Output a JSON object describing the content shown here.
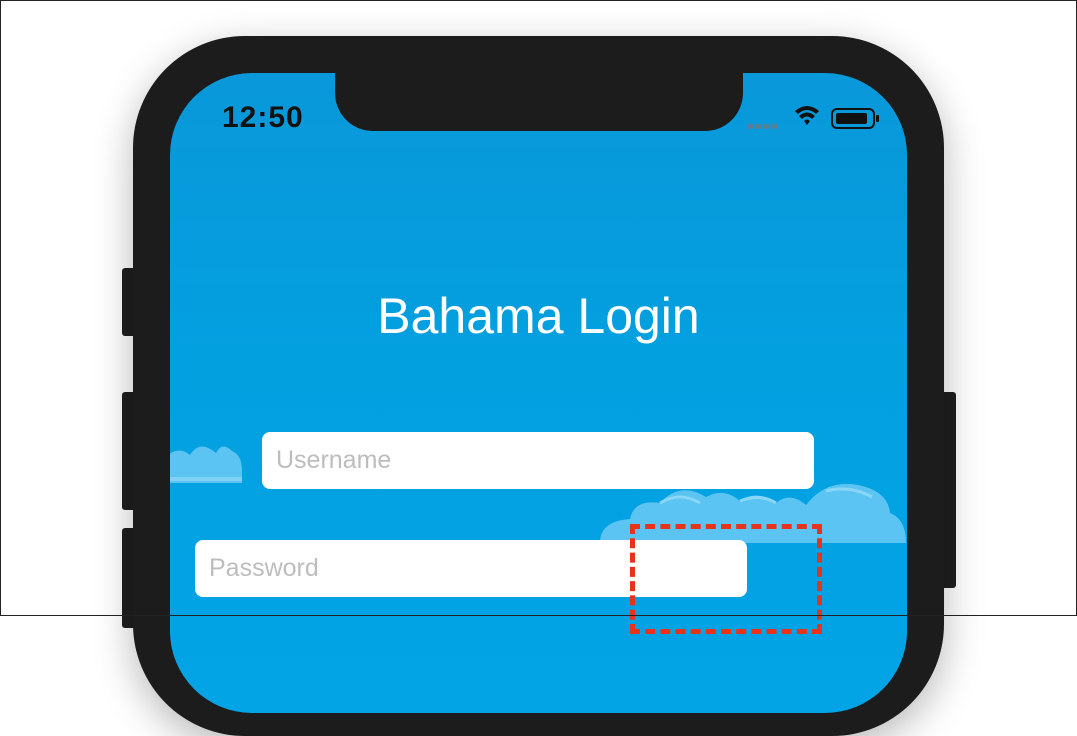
{
  "status_bar": {
    "time": "12:50",
    "icons": [
      "cellular-signal-icon",
      "wifi-icon",
      "battery-icon"
    ]
  },
  "login": {
    "title": "Bahama Login",
    "username_placeholder": "Username",
    "password_placeholder": "Password"
  },
  "colors": {
    "background_blue": "#03a0e0",
    "cloud": "#5cc4f2",
    "device": "#1c1c1c",
    "highlight": "#e8331b"
  }
}
